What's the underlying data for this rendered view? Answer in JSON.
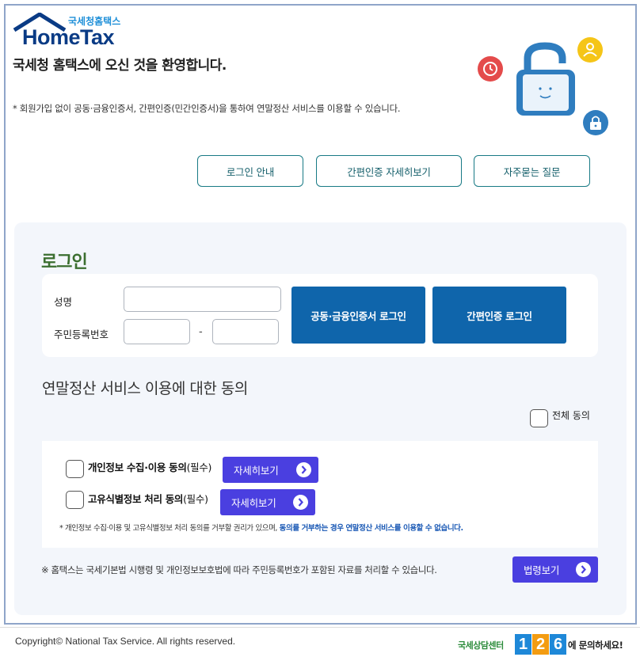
{
  "header": {
    "logo_small": "국세청홈택스",
    "logo_text": "HomeTax",
    "welcome": "국세청 홈택스에 오신 것을 환영합니다.",
    "notice": "* 회원가입 없이 공동·금융인증서, 간편인증(민간인증서)을 통하여 연말정산 서비스를 이용할 수 있습니다."
  },
  "top_buttons": {
    "login_guide": "로그인 안내",
    "simple_auth_detail": "간편인증 자세히보기",
    "faq": "자주묻는 질문"
  },
  "login": {
    "title": "로그인",
    "name_label": "성명",
    "name_value": "",
    "rrn_label": "주민등록번호",
    "rrn_front_value": "",
    "rrn_separator": "-",
    "rrn_back_value": "",
    "cert_login": "공동·금융인증서 로그인",
    "simple_login": "간편인증 로그인"
  },
  "consent": {
    "title": "연말정산 서비스 이용에 대한 동의",
    "agree_all": "전체 동의",
    "items": [
      {
        "label_bold": "개인정보 수집·이용 동의",
        "label_suffix": "(필수)",
        "detail": "자세히보기",
        "checked": false
      },
      {
        "label_bold": "고유식별정보 처리 동의",
        "label_suffix": "(필수)",
        "detail": "자세히보기",
        "checked": false
      }
    ],
    "footnote_plain": "* 개인정보 수집·이용 및 고유식별정보 처리 동의를 거부할 권리가 있으며, ",
    "footnote_highlight": "동의를 거부하는 경우 연말정산 서비스를 이용할 수 없습니다."
  },
  "law": {
    "note": "※ 홈택스는 국세기본법 시행령 및 개인정보보호법에 따라 주민등록번호가 포함된 자료를 처리할 수 있습니다.",
    "button": "법령보기"
  },
  "footer": {
    "copyright": "Copyright© National Tax Service. All rights reserved.",
    "call_label": "국세상담센터",
    "call_digits": [
      "1",
      "2",
      "6"
    ],
    "call_suffix": "에 문의하세요!"
  },
  "colors": {
    "primary_blue": "#0f65ab",
    "purple_button": "#4a3fe0",
    "teal_outline": "#187a85",
    "login_title_green": "#3b6e2f"
  },
  "icons": [
    "house-roof-icon",
    "clock-icon",
    "user-icon",
    "lock-icon",
    "padlock-open-icon",
    "chevron-right-icon"
  ]
}
